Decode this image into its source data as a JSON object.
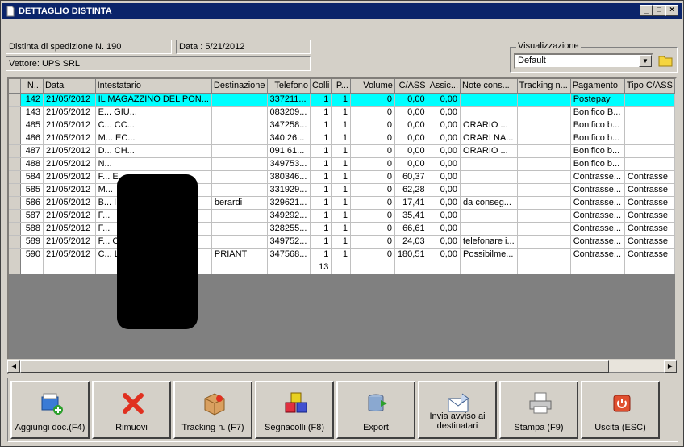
{
  "window": {
    "title": "DETTAGLIO DISTINTA"
  },
  "header": {
    "distinta": "Distinta di spedizione N. 190",
    "data": "Data : 5/21/2012",
    "vettore": "Vettore: UPS SRL"
  },
  "visualizzazione": {
    "label": "Visualizzazione",
    "value": "Default"
  },
  "grid": {
    "columns": [
      "N...",
      "Data",
      "Intestatario",
      "Destinazione",
      "Telefono",
      "Colli",
      "P...",
      "Volume",
      "C/ASS",
      "Assic...",
      "Note cons...",
      "Tracking n...",
      "Pagamento",
      "Tipo C/ASS"
    ],
    "rows": [
      [
        "142",
        "21/05/2012",
        "IL MAGAZZINO DEL PON...",
        "",
        "337211...",
        "1",
        "1",
        "0",
        "0,00",
        "0,00",
        "",
        "",
        "Postepay",
        ""
      ],
      [
        "143",
        "21/05/2012",
        "E... GIU...",
        "",
        "083209...",
        "1",
        "1",
        "0",
        "0,00",
        "0,00",
        "",
        "",
        "Bonifico B...",
        ""
      ],
      [
        "485",
        "21/05/2012",
        "C... CC...",
        "",
        "347258...",
        "1",
        "1",
        "0",
        "0,00",
        "0,00",
        "ORARIO ...",
        "",
        "Bonifico b...",
        ""
      ],
      [
        "486",
        "21/05/2012",
        "M... EC...",
        "",
        "340 26...",
        "1",
        "1",
        "0",
        "0,00",
        "0,00",
        "ORARI NA...",
        "",
        "Bonifico b...",
        ""
      ],
      [
        "487",
        "21/05/2012",
        "D... CH...",
        "",
        "091 61...",
        "1",
        "1",
        "0",
        "0,00",
        "0,00",
        "ORARIO ...",
        "",
        "Bonifico b...",
        ""
      ],
      [
        "488",
        "21/05/2012",
        "N...",
        "",
        "349753...",
        "1",
        "1",
        "0",
        "0,00",
        "0,00",
        "",
        "",
        "Bonifico b...",
        ""
      ],
      [
        "584",
        "21/05/2012",
        "F... E",
        "",
        "380346...",
        "1",
        "1",
        "0",
        "60,37",
        "0,00",
        "",
        "",
        "Contrasse...",
        "Contrasse"
      ],
      [
        "585",
        "21/05/2012",
        "M...",
        "",
        "331929...",
        "1",
        "1",
        "0",
        "62,28",
        "0,00",
        "",
        "",
        "Contrasse...",
        "Contrasse"
      ],
      [
        "586",
        "21/05/2012",
        "B... I",
        "berardi",
        "329621...",
        "1",
        "1",
        "0",
        "17,41",
        "0,00",
        "da conseg...",
        "",
        "Contrasse...",
        "Contrasse"
      ],
      [
        "587",
        "21/05/2012",
        "F...",
        "",
        "349292...",
        "1",
        "1",
        "0",
        "35,41",
        "0,00",
        "",
        "",
        "Contrasse...",
        "Contrasse"
      ],
      [
        "588",
        "21/05/2012",
        "F...",
        "",
        "328255...",
        "1",
        "1",
        "0",
        "66,61",
        "0,00",
        "",
        "",
        "Contrasse...",
        "Contrasse"
      ],
      [
        "589",
        "21/05/2012",
        "F... O",
        "",
        "349752...",
        "1",
        "1",
        "0",
        "24,03",
        "0,00",
        "telefonare i...",
        "",
        "Contrasse...",
        "Contrasse"
      ],
      [
        "590",
        "21/05/2012",
        "C... L",
        "PRIANT",
        "347568...",
        "1",
        "1",
        "0",
        "180,51",
        "0,00",
        "Possibilme...",
        "",
        "Contrasse...",
        "Contrasse"
      ]
    ],
    "total_colli": "13"
  },
  "toolbar": [
    {
      "label": "Aggiungi doc.(F4)",
      "icon": "add-document-icon"
    },
    {
      "label": "Rimuovi",
      "icon": "red-x-icon"
    },
    {
      "label": "Tracking n. (F7)",
      "icon": "package-icon"
    },
    {
      "label": "Segnacolli (F8)",
      "icon": "colored-boxes-icon"
    },
    {
      "label": "Export",
      "icon": "database-export-icon"
    },
    {
      "label": "Invia avviso ai destinatari",
      "icon": "mail-icon"
    },
    {
      "label": "Stampa (F9)",
      "icon": "printer-icon"
    },
    {
      "label": "Uscita (ESC)",
      "icon": "power-icon"
    }
  ]
}
